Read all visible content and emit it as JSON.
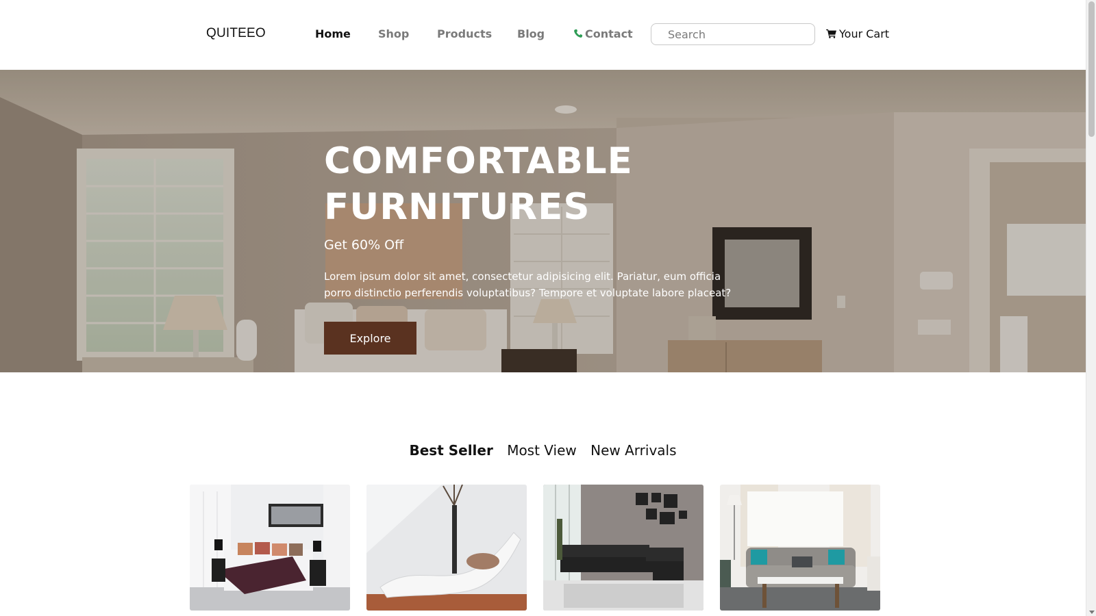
{
  "navbar": {
    "logo": "QUITEEO",
    "links": [
      {
        "label": "Home",
        "active": true
      },
      {
        "label": "Shop",
        "active": false
      },
      {
        "label": "Products",
        "active": false
      },
      {
        "label": "Blog",
        "active": false
      },
      {
        "label": "Contact",
        "active": false,
        "icon": "phone-icon"
      }
    ],
    "search": {
      "placeholder": "Search",
      "value": ""
    },
    "cart": {
      "label": "Your Cart",
      "icon": "cart-icon"
    }
  },
  "hero": {
    "title": "COMFORTABLE FURNITURES",
    "subtitle": "Get 60% Off",
    "text": "Lorem ipsum dolor sit amet, consectetur adipisicing elit. Pariatur, eum officia porro distinctio perferendis voluptatibus? Tempore et voluptate labore placeat?",
    "button_label": "Explore"
  },
  "product_tabs": [
    {
      "label": "Best Seller",
      "active": true
    },
    {
      "label": "Most View",
      "active": false
    },
    {
      "label": "New Arrivals",
      "active": false
    }
  ],
  "products": [
    {
      "image": "bedroom-image"
    },
    {
      "image": "white-lounge-chair-image"
    },
    {
      "image": "black-sectional-sofa-image"
    },
    {
      "image": "grey-sofa-living-room-image"
    }
  ],
  "colors": {
    "accent": "#5a3220",
    "nav_active": "#111111",
    "nav_inactive": "#7a7a7a",
    "contact_icon": "#2e9c55"
  }
}
